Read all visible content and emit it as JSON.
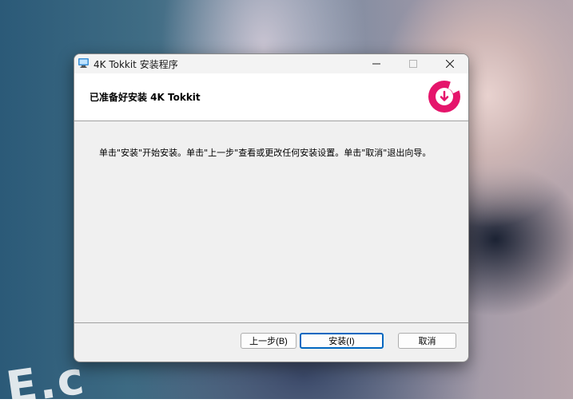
{
  "window": {
    "title": "4K Tokkit 安装程序"
  },
  "header": {
    "title": "已准备好安装 4K Tokkit",
    "logo_color": "#e5156b"
  },
  "body": {
    "message": "单击\"安装\"开始安装。单击\"上一步\"查看或更改任何安装设置。单击\"取消\"退出向导。"
  },
  "buttons": {
    "back": "上一步(B)",
    "install": "安装(I)",
    "cancel": "取消"
  },
  "background": {
    "text": "E.c"
  },
  "icons": {
    "app": "installer-icon",
    "minimize": "minimize-icon",
    "maximize": "maximize-icon",
    "close": "close-icon",
    "logo": "download-logo-icon"
  }
}
